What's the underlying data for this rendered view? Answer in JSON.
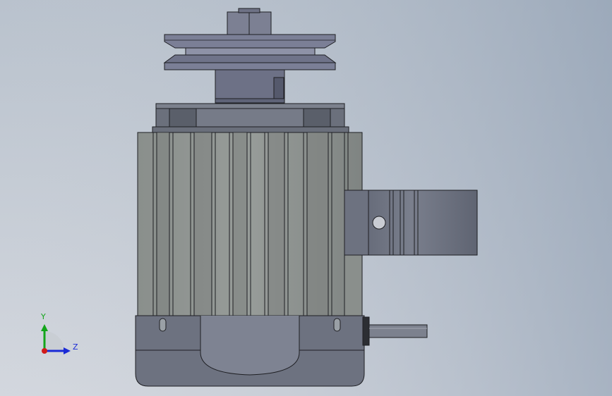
{
  "viewport": {
    "background_top": "#c4cad3",
    "background_bottom": "#7e8da3"
  },
  "triad": {
    "y_label": "Y",
    "z_label": "Z",
    "y_color": "#13a51a",
    "z_color": "#1a2ad6",
    "origin_color": "#d11a1a"
  },
  "model": {
    "name": "motor-with-pulley",
    "body_color": "#8c9290",
    "cap_color": "#6d7280",
    "pulley_color": "#7b7f96",
    "outline_color": "#1e1f23"
  }
}
